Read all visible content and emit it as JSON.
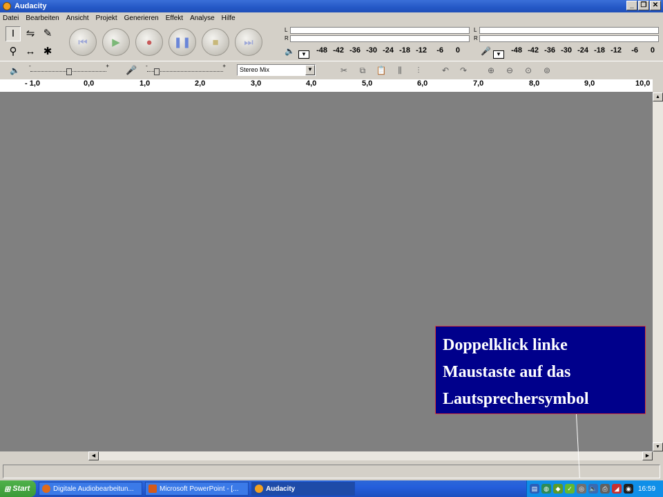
{
  "window": {
    "title": "Audacity"
  },
  "menu": [
    "Datei",
    "Bearbeiten",
    "Ansicht",
    "Projekt",
    "Generieren",
    "Effekt",
    "Analyse",
    "Hilfe"
  ],
  "meters": {
    "labels": {
      "left": "L",
      "right": "R"
    },
    "scale": [
      "-48",
      "-42",
      "-36",
      "-30",
      "-24",
      "-18",
      "-12",
      "-6",
      "0"
    ]
  },
  "mixer": {
    "input_source": "Stereo Mix",
    "slider_minus": "-",
    "slider_plus": "+"
  },
  "ruler": [
    "- 1,0",
    "0,0",
    "1,0",
    "2,0",
    "3,0",
    "4,0",
    "5,0",
    "6,0",
    "7,0",
    "8,0",
    "9,0",
    "10,0"
  ],
  "callout": {
    "line1": "Doppelklick linke",
    "line2": "Maustaste auf  das",
    "line3": "Lautsprechersymbol"
  },
  "taskbar": {
    "start": "Start",
    "tasks": [
      "Digitale Audiobearbeitun...",
      "Microsoft PowerPoint - [...",
      "Audacity"
    ],
    "clock": "16:59"
  }
}
